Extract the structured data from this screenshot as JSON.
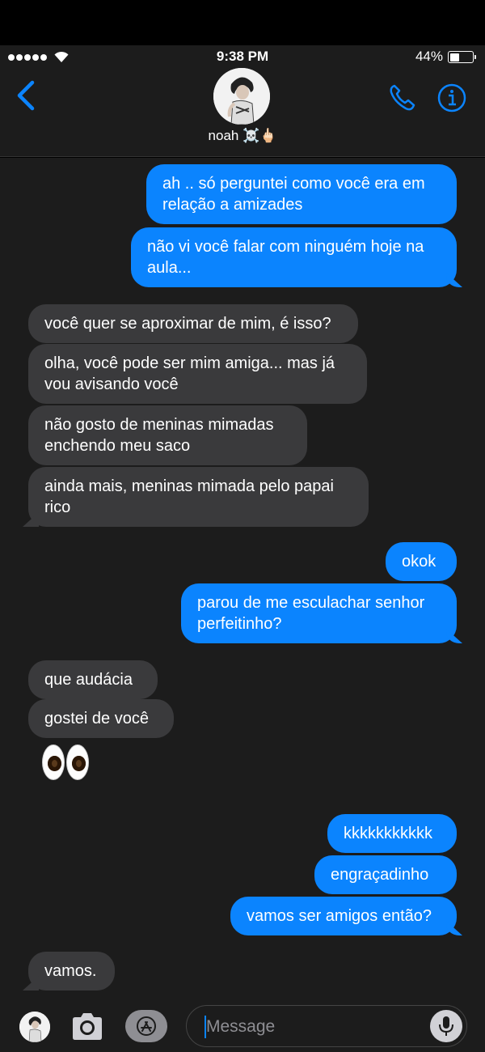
{
  "status_bar": {
    "time": "9:38 PM",
    "battery_percent": "44%",
    "battery_level": 0.44,
    "signal_bars_filled": 5
  },
  "header": {
    "contact_name": "noah ☠️🖕🏻",
    "back_icon": "chevron-left-icon",
    "call_icon": "phone-icon",
    "info_icon": "info-icon"
  },
  "messages": [
    {
      "side": "out",
      "text_lines": [
        "ah .. só perguntei como você era em",
        "relação a amizades"
      ]
    },
    {
      "side": "out",
      "text_lines": [
        "não vi você falar com ninguém hoje na",
        "aula..."
      ]
    },
    {
      "side": "in",
      "text_lines": [
        "você quer se aproximar de mim, é isso?"
      ]
    },
    {
      "side": "in",
      "text_lines": [
        "olha, você pode ser mim amiga... mas já",
        "vou avisando você"
      ]
    },
    {
      "side": "in",
      "text_lines": [
        "não gosto de meninas mimadas",
        "enchendo meu saco"
      ]
    },
    {
      "side": "in",
      "text_lines": [
        "ainda mais, meninas mimada pelo papai",
        "rico"
      ]
    },
    {
      "side": "out",
      "text_lines": [
        "okok"
      ]
    },
    {
      "side": "out",
      "text_lines": [
        "parou de me esculachar senhor",
        "perfeitinho?"
      ]
    },
    {
      "side": "in",
      "text_lines": [
        "que audácia"
      ]
    },
    {
      "side": "in",
      "text_lines": [
        "gostei de você"
      ]
    },
    {
      "side": "in",
      "emoji": "👀"
    },
    {
      "side": "out",
      "text_lines": [
        "kkkkkkkkkkk"
      ]
    },
    {
      "side": "out",
      "text_lines": [
        "engraçadinho"
      ]
    },
    {
      "side": "out",
      "text_lines": [
        "vamos ser amigos então?"
      ]
    },
    {
      "side": "in",
      "text_lines": [
        "vamos."
      ]
    }
  ],
  "composer": {
    "placeholder": "Message",
    "camera_icon": "camera-icon",
    "apps_icon": "app-store-icon",
    "mic_icon": "microphone-icon"
  },
  "colors": {
    "outgoing_bubble": "#0b84fe",
    "incoming_bubble": "#3a3a3c",
    "background": "#1c1c1c",
    "accent": "#0b84fe"
  }
}
